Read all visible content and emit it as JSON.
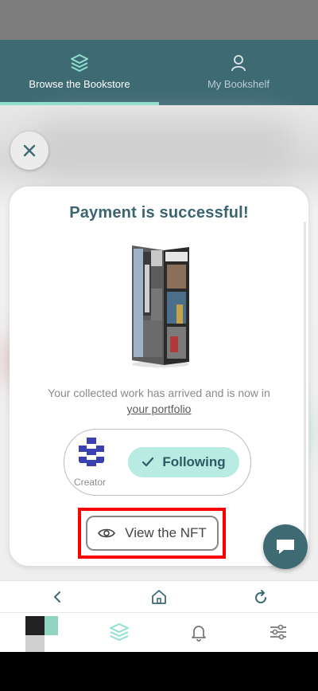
{
  "tabs": [
    {
      "label": "Browse the Bookstore",
      "icon": "layers-icon",
      "active": true
    },
    {
      "label": "My Bookshelf",
      "icon": "user-icon",
      "active": false
    }
  ],
  "modal": {
    "title": "Payment is successful!",
    "message": "Your collected work has arrived and is now in",
    "portfolio_link": "your portfolio",
    "creator_label": "Creator",
    "follow_label": "Following",
    "view_nft_label": "View the NFT"
  },
  "colors": {
    "brand": "#3e6a73",
    "accent": "#8fe0cf",
    "follow_bg": "#b8ebe2",
    "highlight": "#ff0000"
  },
  "browser_bar": {
    "icons": [
      "back-icon",
      "home-icon",
      "reload-icon"
    ]
  },
  "bottom_nav": {
    "icons": [
      "thumbnail",
      "layers-icon",
      "bell-icon",
      "sliders-icon"
    ]
  }
}
